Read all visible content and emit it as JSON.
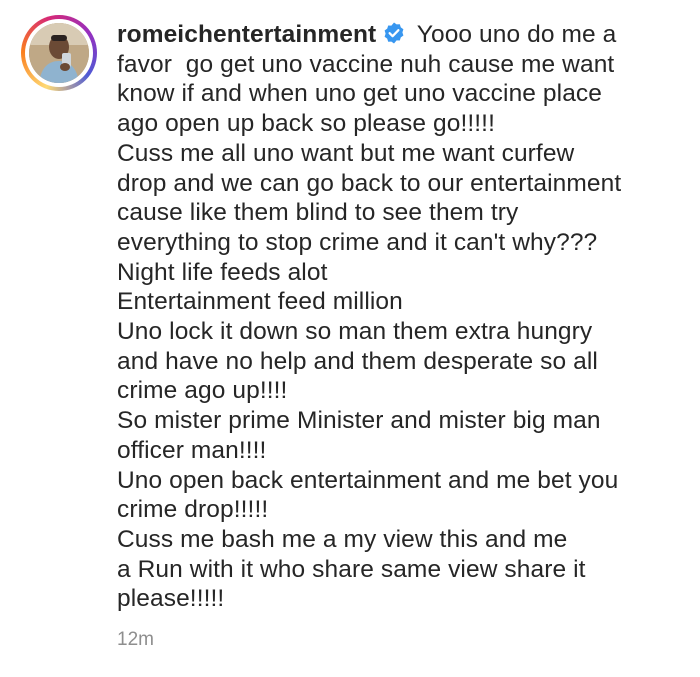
{
  "comment": {
    "username": "romeichentertainment",
    "verified": true,
    "verified_icon": "verified-badge-icon",
    "accent_color": "#3897f0",
    "first_line_text": "Yooo uno do me a",
    "lines": [
      "favor  go get uno vaccine nuh cause me want",
      "know if and when uno get uno vaccine place",
      "ago open up back so please go!!!!!",
      "Cuss me all uno want but me want curfew",
      "drop and we can go back to our entertainment",
      "cause like them blind to see them try",
      "everything to stop crime and it can't why???",
      "Night life feeds alot",
      "Entertainment feed million",
      "Uno lock it down so man them extra hungry",
      "and have no help and them desperate so all",
      "crime ago up!!!!",
      "So mister prime Minister and mister big man",
      "officer man!!!!",
      "Uno open back entertainment and me bet you",
      "crime drop!!!!!",
      "Cuss me bash me a my view this and me",
      "a Run with it who share same view share it",
      "please!!!!!"
    ],
    "timestamp": "12m"
  }
}
